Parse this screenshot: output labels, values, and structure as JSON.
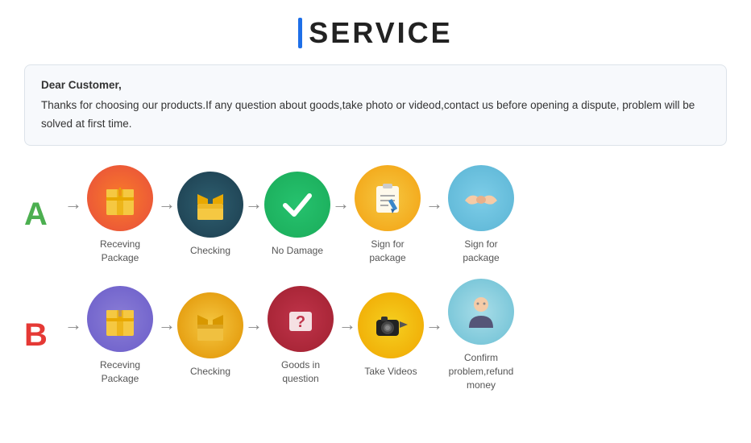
{
  "title": "SERVICE",
  "notice": {
    "greeting": "Dear Customer,",
    "body": "Thanks for choosing our products.If any question about goods,take photo or videod,contact us before opening a dispute, problem will be solved at first time."
  },
  "row_a": {
    "letter": "A",
    "items": [
      {
        "label": "Receving Package"
      },
      {
        "label": "Checking"
      },
      {
        "label": "No Damage"
      },
      {
        "label": "Sign for package"
      },
      {
        "label": "Sign for package"
      }
    ]
  },
  "row_b": {
    "letter": "B",
    "items": [
      {
        "label": "Receving Package"
      },
      {
        "label": "Checking"
      },
      {
        "label": "Goods in question"
      },
      {
        "label": "Take Videos"
      },
      {
        "label": "Confirm problem,refund money"
      }
    ]
  }
}
